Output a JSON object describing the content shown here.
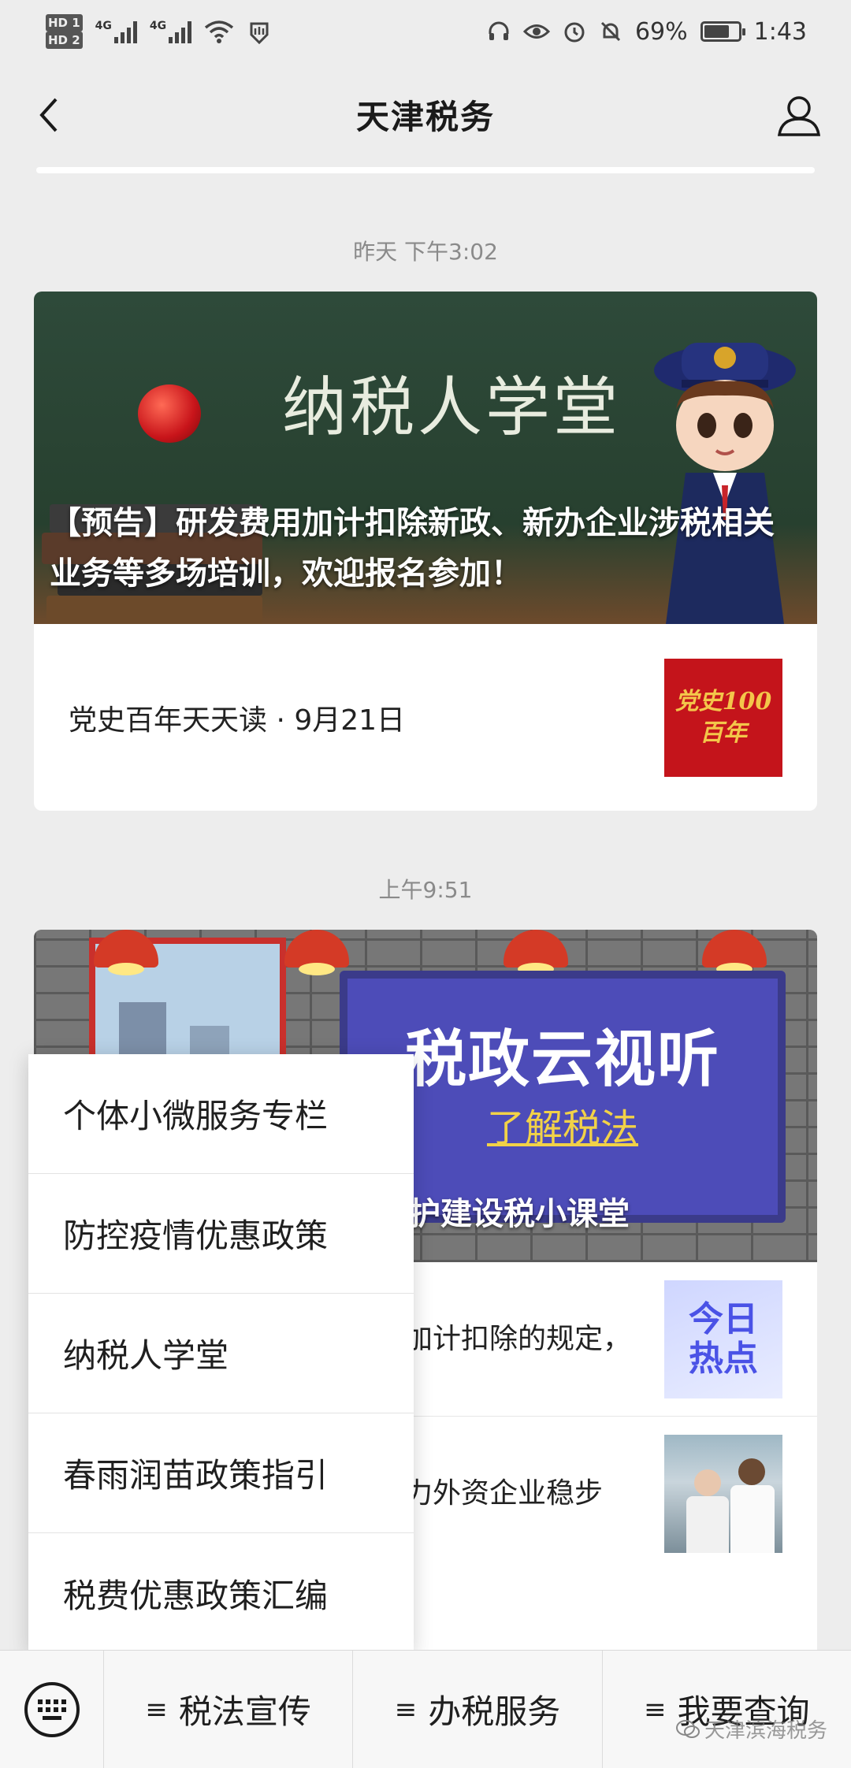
{
  "status_bar": {
    "hd1": "HD 1",
    "hd2": "HD 2",
    "net1": "4G",
    "net2": "4G",
    "battery_percent": "69%",
    "battery_level": 0.69,
    "time": "1:43"
  },
  "nav": {
    "title": "天津税务"
  },
  "feed": {
    "timestamp1": "昨天 下午3:02",
    "card1": {
      "cover_title": "纳税人学堂",
      "cover_caption": "【预告】研发费用加计扣除新政、新办企业涉税相关业务等多场培训，欢迎报名参加！",
      "sub_title": "党史百年天天读 · 9月21日",
      "thumb_text": "党史100百年"
    },
    "timestamp2": "上午9:51",
    "card2": {
      "board_title": "税政云视听",
      "board_sub": "了解税法",
      "cover_caption": "护建设税小课堂",
      "rows": [
        {
          "text": "加计扣除的规定，",
          "thumb_line1": "今日",
          "thumb_line2": "热点"
        },
        {
          "text": "力外资企业稳步"
        }
      ]
    }
  },
  "popup_menu": {
    "items": [
      "个体小微服务专栏",
      "防控疫情优惠政策",
      "纳税人学堂",
      "春雨润苗政策指引",
      "税费优惠政策汇编"
    ]
  },
  "bottom_bar": {
    "menus": [
      "税法宣传",
      "办税服务",
      "我要查询"
    ],
    "watermark": "天津滨海税务"
  }
}
